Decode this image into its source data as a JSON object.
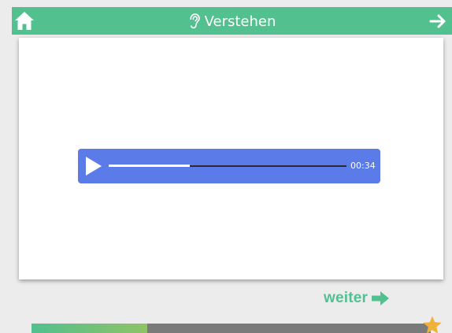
{
  "header": {
    "title": "Verstehen",
    "title_icon": "ear-icon",
    "left_icon": "home-icon",
    "right_icon": "arrow-right-icon",
    "background": "#52c08f"
  },
  "audio_player": {
    "time": "00:34",
    "played_fraction": 0.34,
    "play_icon": "play-icon",
    "background": "#5b7be8"
  },
  "continue_button": {
    "label": "weiter",
    "icon": "arrow-right-icon",
    "color": "#52c08f"
  },
  "lesson_progress": {
    "fraction": 0.29,
    "end_icon": "star-icon",
    "fill_color": "#52c08f",
    "track_color": "#7a7a7a",
    "star_color": "#f0b13b"
  }
}
